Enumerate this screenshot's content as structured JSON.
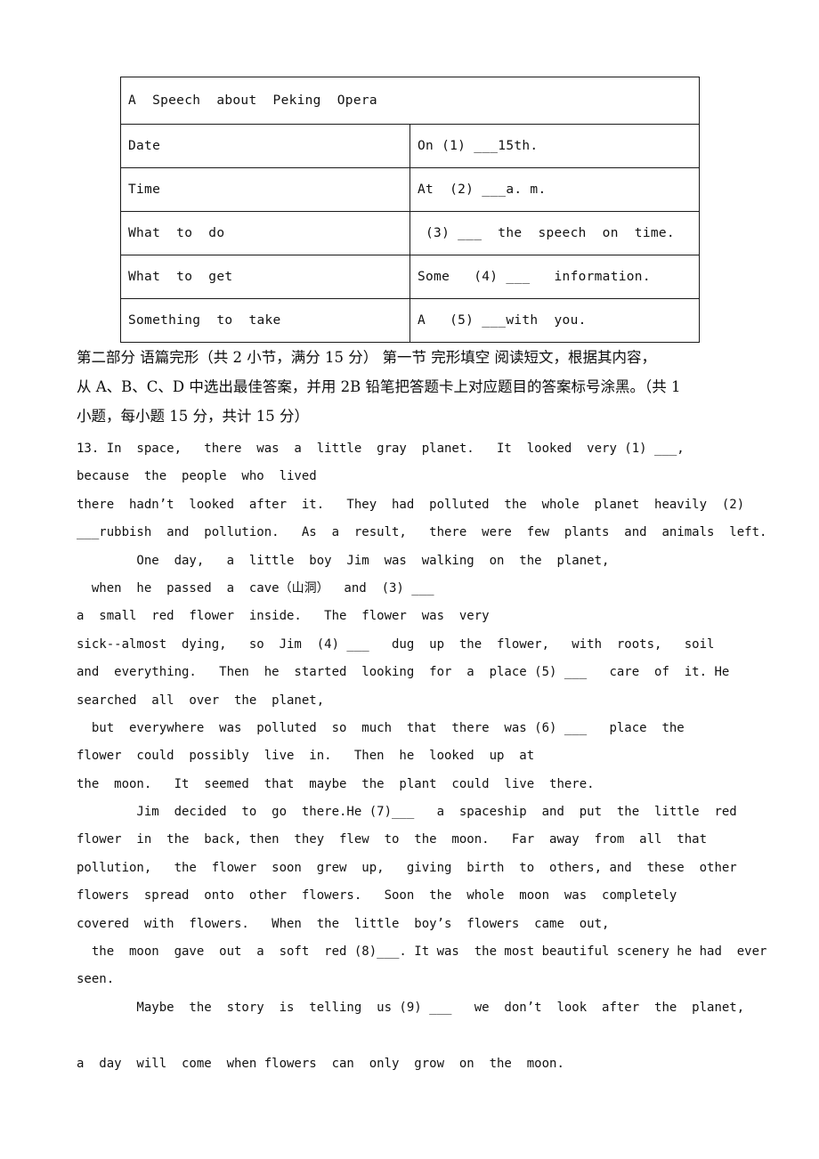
{
  "info_table": {
    "title": "A  Speech  about  Peking  Opera",
    "rows": [
      {
        "label": "Date",
        "value": "On (1) ___15th."
      },
      {
        "label": "Time",
        "value": "At  (2) ___a. m."
      },
      {
        "label": "What  to  do",
        "value": " (3) ___  the  speech  on  time."
      },
      {
        "label": "What  to  get",
        "value": "Some   (4) ___   information."
      },
      {
        "label": "Something  to  take",
        "value": "A   (5) ___with  you."
      }
    ]
  },
  "instructions": {
    "line1": "第二部分 语篇完形（共 2 小节，满分 15 分） 第一节 完形填空 阅读短文，根据其内容，",
    "line2": "从 A、B、C、D 中选出最佳答案，并用 2B 铅笔把答题卡上对应题目的答案标号涂黑。（共 1",
    "line3": "小题，每小题 15 分，共计 15 分）"
  },
  "passage": {
    "lines": [
      "13. In  space,   there  was  a  little  gray  planet.   It  looked  very (1) ___,",
      "because  the  people  who  lived",
      "there  hadn’t  looked  after  it.   They  had  polluted  the  whole  planet  heavily  (2)",
      "___rubbish  and  pollution.   As  a  result,   there  were  few  plants  and  animals  left.",
      "        One  day,   a  little  boy  Jim  was  walking  on  the  planet,",
      "  when  he  passed  a  cave（山洞）  and  (3) ___",
      "a  small  red  flower  inside.   The  flower  was  very",
      "sick--almost  dying,   so  Jim  (4) ___   dug  up  the  flower,   with  roots,   soil",
      "and  everything.   Then  he  started  looking  for  a  place (5) ___   care  of  it. He",
      "searched  all  over  the  planet,",
      "  but  everywhere  was  polluted  so  much  that  there  was (6) ___   place  the",
      "flower  could  possibly  live  in.   Then  he  looked  up  at",
      "the  moon.   It  seemed  that  maybe  the  plant  could  live  there.",
      "        Jim  decided  to  go  there.He (7)___   a  spaceship  and  put  the  little  red",
      "flower  in  the  back, then  they  flew  to  the  moon.   Far  away  from  all  that",
      "pollution,   the  flower  soon  grew  up,   giving  birth  to  others, and  these  other",
      "flowers  spread  onto  other  flowers.   Soon  the  whole  moon  was  completely",
      "covered  with  flowers.   When  the  little  boy’s  flowers  came  out,",
      "  the  moon  gave  out  a  soft  red (8)___. It was  the most beautiful scenery he had  ever",
      "seen.",
      "        Maybe  the  story  is  telling  us (9) ___   we  don’t  look  after  the  planet,",
      "",
      "a  day  will  come  when flowers  can  only  grow  on  the  moon."
    ]
  }
}
